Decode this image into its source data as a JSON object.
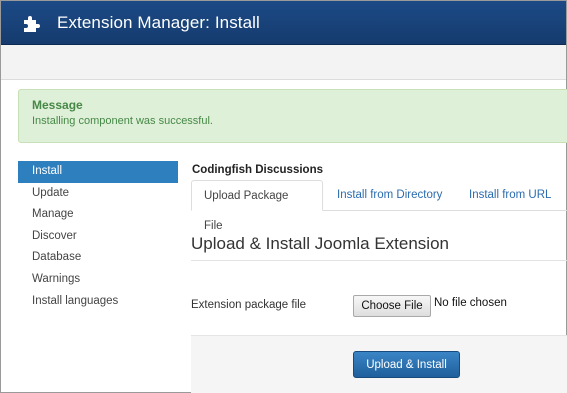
{
  "header": {
    "title": "Extension Manager: Install",
    "icon": "puzzle-icon"
  },
  "message": {
    "title": "Message",
    "text": "Installing component was successful."
  },
  "sidebar": {
    "items": [
      {
        "label": "Install",
        "active": true
      },
      {
        "label": "Update"
      },
      {
        "label": "Manage"
      },
      {
        "label": "Discover"
      },
      {
        "label": "Database"
      },
      {
        "label": "Warnings"
      },
      {
        "label": "Install languages"
      }
    ]
  },
  "main": {
    "component_name": "Codingfish Discussions",
    "tabs": [
      {
        "label": "Upload Package File",
        "active": true
      },
      {
        "label": "Install from Directory"
      },
      {
        "label": "Install from URL"
      }
    ],
    "heading": "Upload & Install Joomla Extension",
    "field_label": "Extension package file",
    "choose_button": "Choose File",
    "no_file_text": "No file chosen",
    "install_button": "Upload & Install"
  },
  "colors": {
    "header": "#1c4a86",
    "message_bg": "#dff0d8",
    "message_text": "#468847",
    "sidebar_active": "#2d7fbd",
    "tab_link": "#2b6cb0",
    "primary_button": "#2a72b5"
  }
}
